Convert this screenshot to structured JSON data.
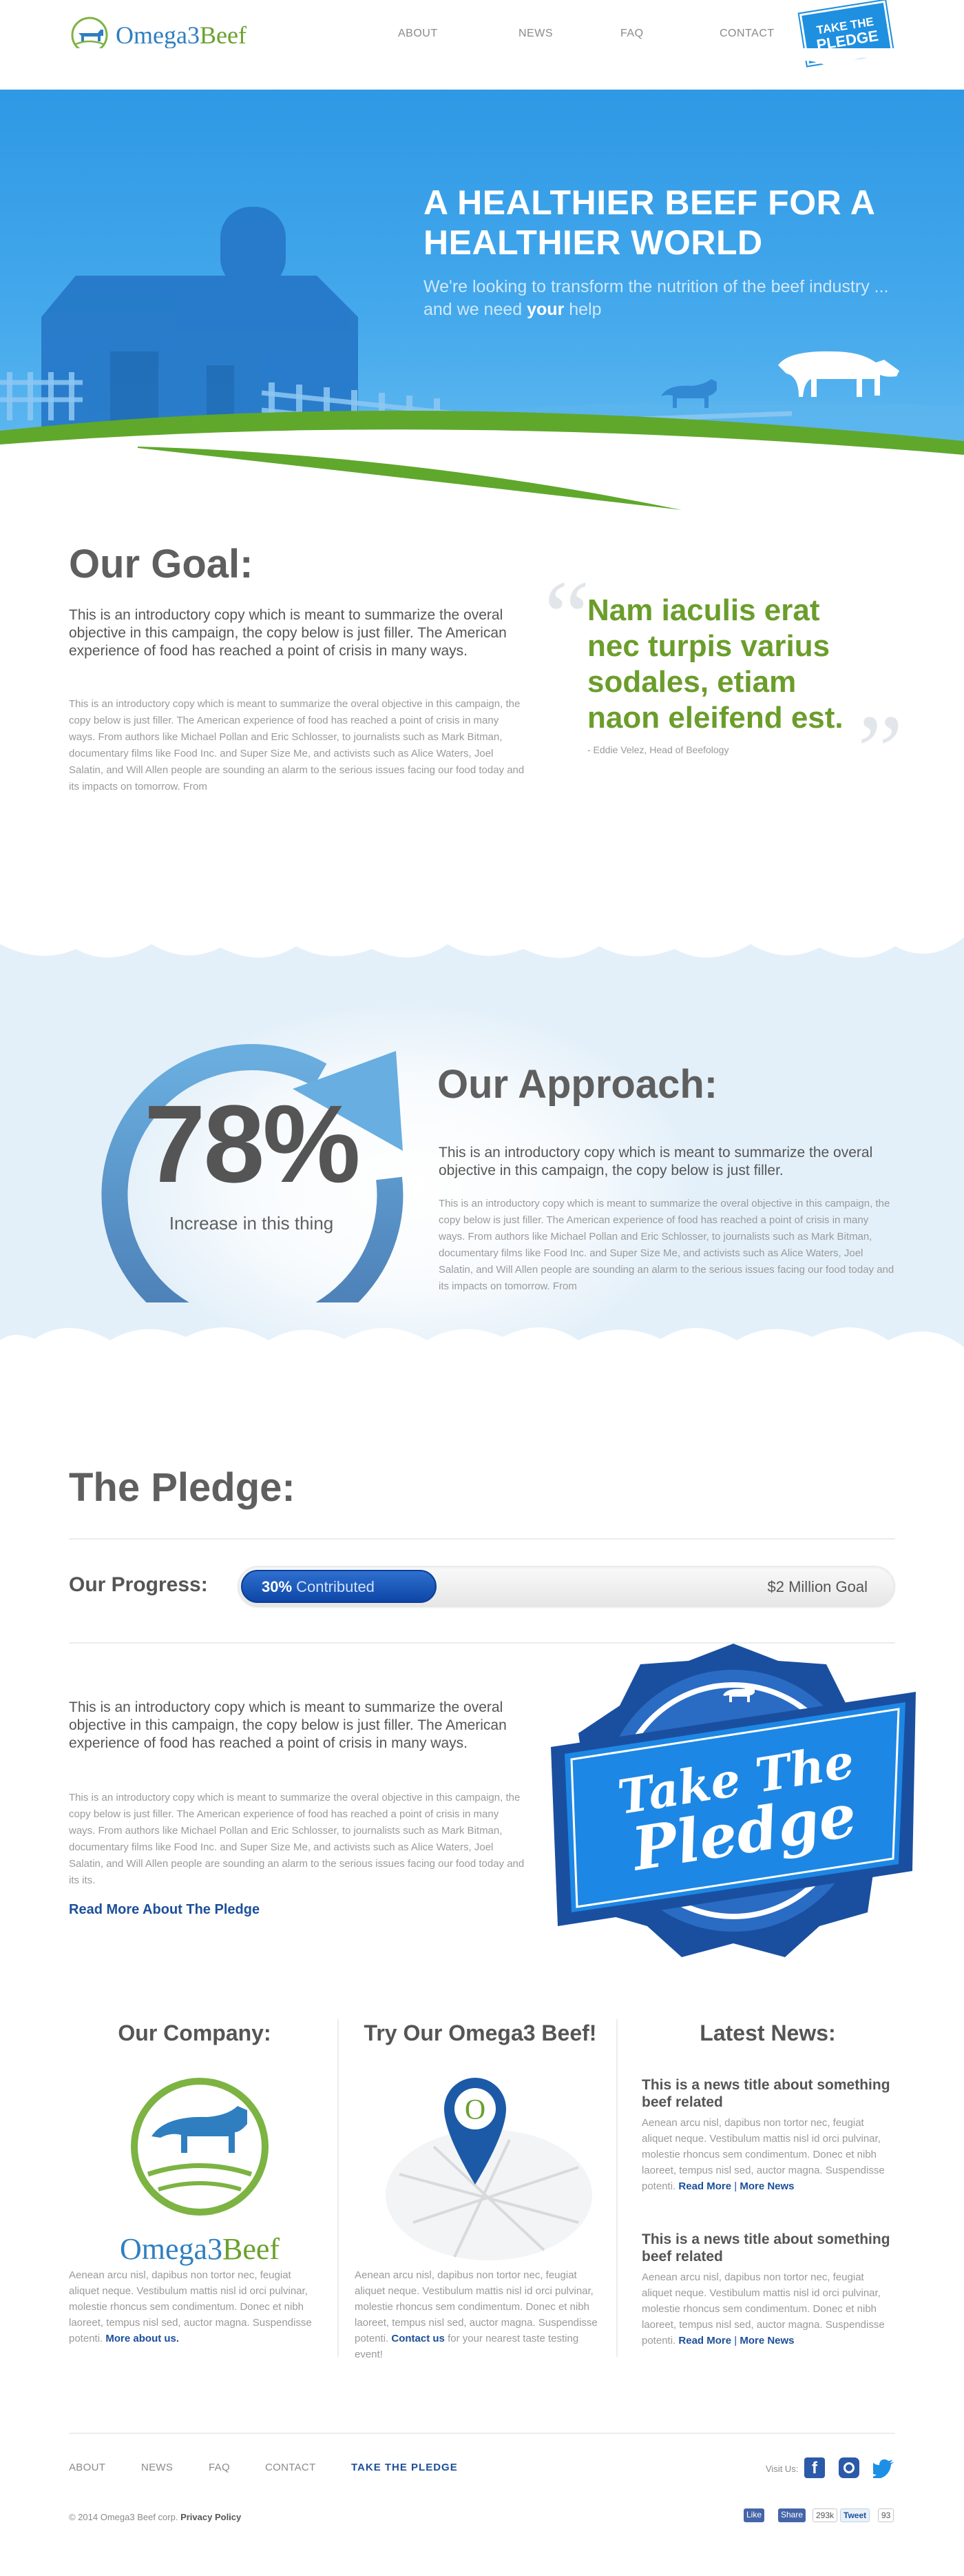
{
  "brand": {
    "name_part1": "Omega3",
    "name_part2": "Beef",
    "colors": {
      "blue": "#2f7fc0",
      "green": "#6aa12e",
      "sky": "#2c97e4",
      "navy": "#1c4f9a"
    }
  },
  "nav": [
    {
      "label": "ABOUT"
    },
    {
      "label": "NEWS"
    },
    {
      "label": "FAQ"
    },
    {
      "label": "CONTACT"
    }
  ],
  "pledge_badge": {
    "line1": "TAKE THE",
    "line2": "PLEDGE"
  },
  "hero": {
    "title": "A HEALTHIER BEEF FOR A HEALTHIER WORLD",
    "subtitle_part1": "We're looking to transform the nutrition of the beef industry ... and we need ",
    "subtitle_emphasis": "your",
    "subtitle_part2": " help"
  },
  "goal": {
    "title": "Our Goal:",
    "lead": "This is an introductory copy which is meant to summarize the overal objective in this campaign, the copy below is just filler. The American experience of food has reached a point of crisis in many ways.",
    "body": "This is an introductory copy which is meant to summarize the overal objective in this campaign, the copy below is just filler. The American experience of food has reached a point of crisis in many ways. From authors like Michael Pollan and Eric Schlosser, to journalists such as Mark Bitman, documentary films like Food Inc. and Super Size Me, and activists such as Alice Waters, Joel Salatin, and Will Allen people are sounding an alarm to the serious issues facing our food today and its impacts on tomorrow. From",
    "quote": "Nam iaculis erat nec turpis varius sodales, etiam naon eleifend est.",
    "quote_author": "- Eddie Velez, Head of Beefology"
  },
  "approach": {
    "stat_value": "78%",
    "stat_fraction": 0.78,
    "stat_label": "Increase in this thing",
    "title": "Our Approach:",
    "lead": "This is an introductory copy which is meant to summarize the overal objective in this campaign, the copy below is just filler.",
    "body": "This is an introductory copy which is meant to summarize the overal objective in this campaign, the copy below is just filler. The American experience of food has reached a point of crisis in many ways. From authors like Michael Pollan and Eric Schlosser, to journalists such as Mark Bitman, documentary films like Food Inc. and Super Size Me, and activists such as Alice Waters, Joel Salatin, and Will Allen people are sounding an alarm to the serious issues facing our food today and its impacts on tomorrow. From"
  },
  "pledge": {
    "title": "The Pledge:",
    "progress_label": "Our Progress:",
    "progress_percent_text": "30%",
    "progress_fraction": 0.3,
    "progress_contributed": "Contributed",
    "progress_goal": "$2 Million Goal",
    "lead": "This is an introductory copy which is meant to summarize the overal objective in this campaign, the copy below is just filler. The American experience of food has reached a point of crisis in many ways.",
    "body": "This is an introductory copy which is meant to summarize the overal objective in this campaign, the copy below is just filler. The American experience of food has reached a point of crisis in many ways. From authors like Michael Pollan and Eric Schlosser, to journalists such as Mark Bitman, documentary films like Food Inc. and Super Size Me, and activists such as Alice Waters, Joel Salatin, and Will Allen people are sounding an alarm to the serious issues facing our food today and its its.",
    "read_more": "Read More About The Pledge",
    "banner_line1": "Take The",
    "banner_line2": "Pledge"
  },
  "company": {
    "title": "Our Company:",
    "copy": "Aenean arcu nisl, dapibus non tortor nec, feugiat aliquet neque. Vestibulum mattis nisl id orci pulvinar, molestie rhoncus sem condimentum. Donec et nibh laoreet, tempus nisl sed, auctor magna. Suspendisse potenti.",
    "link": "More about us."
  },
  "try": {
    "title": "Try Our Omega3 Beef!",
    "pin_letter": "O",
    "copy_before": "Aenean arcu nisl, dapibus non tortor nec, feugiat aliquet neque. Vestibulum mattis nisl id orci pulvinar, molestie rhoncus sem condimentum. Donec et nibh laoreet, tempus nisl sed, auctor magna. Suspendisse potenti.",
    "link": "Contact us",
    "copy_after": "for your nearest taste testing event!"
  },
  "news": {
    "title": "Latest News:",
    "items": [
      {
        "headline": "This is a news title about something beef related",
        "copy": "Aenean arcu nisl, dapibus non tortor nec, feugiat aliquet neque. Vestibulum mattis nisl id orci pulvinar, molestie rhoncus sem condimentum. Donec et nibh laoreet, tempus nisl sed, auctor magna. Suspendisse potenti.",
        "read_more": "Read More",
        "separator": "|",
        "more_news": "More News"
      },
      {
        "headline": "This is a news title about something beef related",
        "copy": "Aenean arcu nisl, dapibus non tortor nec, feugiat aliquet neque. Vestibulum mattis nisl id orci pulvinar, molestie rhoncus sem condimentum. Donec et nibh laoreet, tempus nisl sed, auctor magna. Suspendisse potenti.",
        "read_more": "Read More",
        "separator": "|",
        "more_news": "More News"
      }
    ]
  },
  "footer": {
    "nav": [
      {
        "label": "ABOUT"
      },
      {
        "label": "NEWS"
      },
      {
        "label": "FAQ"
      },
      {
        "label": "CONTACT"
      },
      {
        "label": "TAKE THE PLEDGE"
      }
    ],
    "visit_us": "Visit Us:",
    "copyright": "© 2014 Omega3 Beef corp.",
    "privacy": "Privacy Policy",
    "social": {
      "fb_like": "Like",
      "fb_share": "Share",
      "fb_count": "293k",
      "tweet": "Tweet",
      "tweet_count": "93"
    }
  }
}
